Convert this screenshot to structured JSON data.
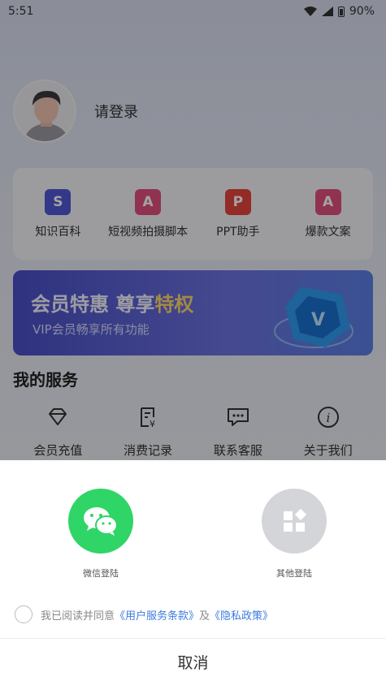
{
  "status_bar": {
    "time": "5:51",
    "battery": "90%"
  },
  "profile": {
    "login_text": "请登录"
  },
  "tools": [
    {
      "label": "知识百科",
      "icon": "book-s-icon",
      "glyph": "S",
      "color": "#5158d6"
    },
    {
      "label": "短视频拍摄脚本",
      "icon": "script-a-icon",
      "glyph": "A",
      "color": "#e2507e"
    },
    {
      "label": "PPT助手",
      "icon": "ppt-icon",
      "glyph": "P",
      "color": "#e6443c"
    },
    {
      "label": "爆款文案",
      "icon": "copywriting-a-icon",
      "glyph": "A",
      "color": "#e2507e"
    }
  ],
  "vip": {
    "title_main": "会员特惠 尊享",
    "title_highlight": "特权",
    "subtitle": "VIP会员畅享所有功能"
  },
  "services": {
    "title": "我的服务",
    "items": [
      {
        "label": "会员充值",
        "icon": "diamond-icon"
      },
      {
        "label": "消费记录",
        "icon": "receipt-icon"
      },
      {
        "label": "联系客服",
        "icon": "chat-icon"
      },
      {
        "label": "关于我们",
        "icon": "info-icon"
      }
    ]
  },
  "sheet": {
    "wechat_label": "微信登陆",
    "other_label": "其他登陆",
    "agree_prefix": "我已阅读并同意",
    "terms_link": "《用户服务条款》",
    "and_text": "及",
    "privacy_link": "《隐私政策》",
    "cancel_label": "取消",
    "wechat_color": "#2fd566",
    "other_color": "#d3d5d9"
  }
}
